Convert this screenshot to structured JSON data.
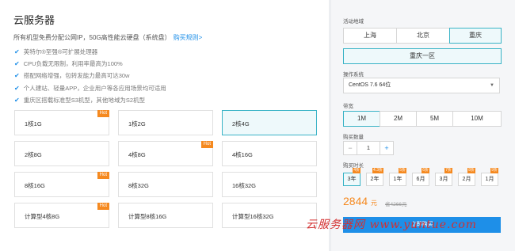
{
  "main": {
    "title": "云服务器",
    "subtitle": "所有机型免费分配公网IP，50G高性能云硬盘（系统盘）",
    "subtitle_link": "购买规则>",
    "features": [
      "英特尔®至强®可扩展处理器",
      "CPU负载无限制，利用率最高为100%",
      "搭配网络增强，包转发能力最高可达30w",
      "个人建站、轻量APP，企业用户等各应用场景均可适用",
      "重庆区搭载标准型S3机型，其他地域为S2机型"
    ],
    "plans": [
      {
        "label": "1核1G",
        "hot": "Hot"
      },
      {
        "label": "1核2G",
        "hot": ""
      },
      {
        "label": "2核4G",
        "hot": ""
      },
      {
        "label": "2核8G",
        "hot": ""
      },
      {
        "label": "4核8G",
        "hot": "Hot"
      },
      {
        "label": "4核16G",
        "hot": ""
      },
      {
        "label": "8核16G",
        "hot": "Hot"
      },
      {
        "label": "8核32G",
        "hot": ""
      },
      {
        "label": "16核32G",
        "hot": ""
      },
      {
        "label": "计算型4核8G",
        "hot": "Hot"
      },
      {
        "label": "计算型8核16G",
        "hot": ""
      },
      {
        "label": "计算型16核32G",
        "hot": ""
      }
    ],
    "selected_plan": "2核4G"
  },
  "panel": {
    "region_label": "活动地域",
    "regions": [
      "上海",
      "北京",
      "重庆"
    ],
    "selected_region": "重庆",
    "zone": "重庆一区",
    "os_label": "操作系统",
    "os_value": "CentOS 7.6 64位",
    "bw_label": "带宽",
    "bandwidth": [
      "1M",
      "2M",
      "5M",
      "10M"
    ],
    "selected_bw": "1M",
    "qty_label": "购买数量",
    "qty_minus": "−",
    "qty_value": "1",
    "qty_plus": "+",
    "dur_label": "购买时长",
    "durations": [
      {
        "label": "3年",
        "tag": "4折"
      },
      {
        "label": "2年",
        "tag": "4.3折"
      },
      {
        "label": "1年",
        "tag": "5折"
      },
      {
        "label": "6月",
        "tag": "6折"
      },
      {
        "label": "3月",
        "tag": "7折"
      },
      {
        "label": "2月",
        "tag": "8折"
      },
      {
        "label": "1月",
        "tag": "9折"
      }
    ],
    "selected_dur": "3年",
    "price": "2844",
    "price_unit": "元",
    "old_price": "省4266元",
    "buy": "立即购买"
  },
  "watermark": "云服务器网 www.yuntue.com"
}
